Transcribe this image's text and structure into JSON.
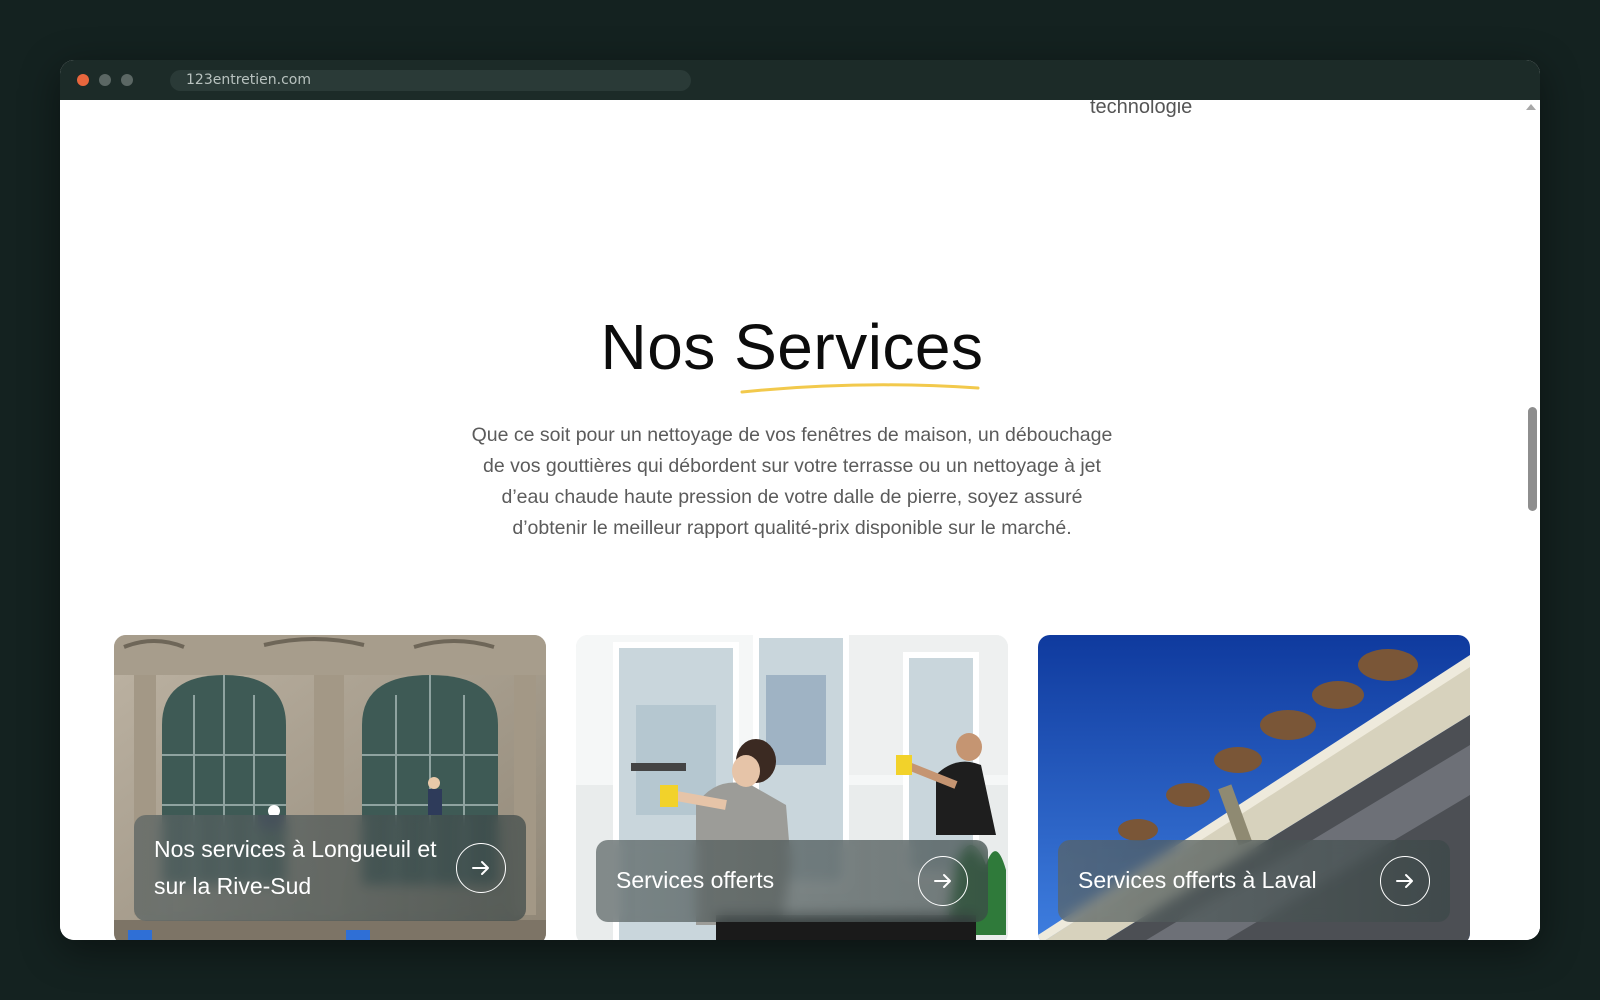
{
  "browser": {
    "url": "123entretien.com"
  },
  "feature": {
    "label": "technologie",
    "icon": "leaf-check-icon"
  },
  "services_section": {
    "title": "Nos Services",
    "intro": "Que ce soit pour un nettoyage de vos fenêtres de maison, un débouchage de vos gouttières qui débordent sur votre terrasse ou un nettoyage à jet d’eau chaude haute pression de votre dalle de pierre, soyez assuré d’obtenir le meilleur rapport qualité-prix disponible sur le marché.",
    "underline_color": "#f2c94c",
    "cards": [
      {
        "title": "Nos services à Longueuil et sur la Rive-Sud",
        "icon": "arrow-right-icon"
      },
      {
        "title": "Services offerts",
        "icon": "arrow-right-icon"
      },
      {
        "title": "Services offerts à Laval",
        "icon": "arrow-right-icon"
      }
    ]
  },
  "colors": {
    "accent": "#f2c94c",
    "brand_dark": "#1c2b28",
    "close_dot": "#e8663d"
  }
}
